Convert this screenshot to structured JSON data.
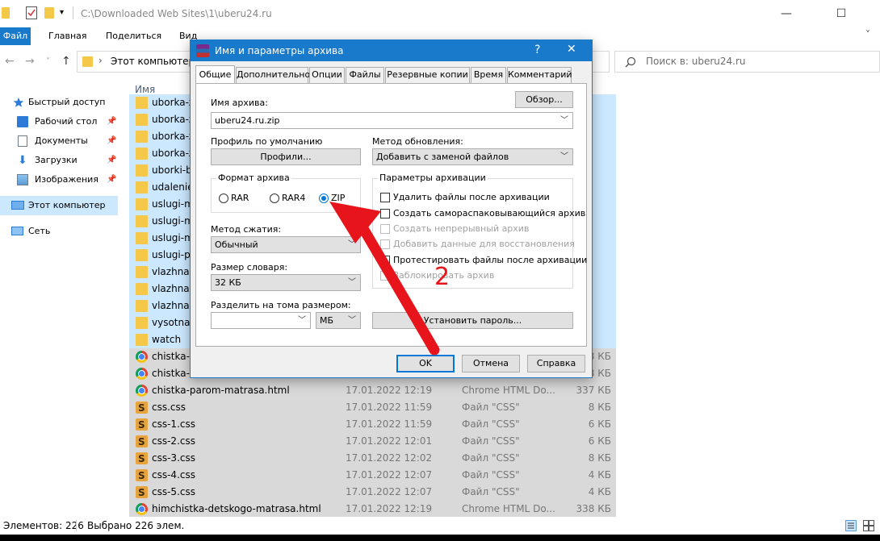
{
  "window": {
    "title_path": "C:\\Downloaded Web Sites\\1\\uberu24.ru",
    "minimize_glyph": "—",
    "maximize_glyph": "☐",
    "close_glyph": "✕"
  },
  "ribbon": {
    "tabs": [
      "Файл",
      "Главная",
      "Поделиться",
      "Вид"
    ]
  },
  "address": {
    "path_label": "Этот компьютер",
    "search_placeholder": "Поиск в: uberu24.ru"
  },
  "nav": {
    "items": [
      {
        "label": "Быстрый доступ",
        "icon": "star-icon"
      },
      {
        "label": "Рабочий стол",
        "icon": "desktop-icon"
      },
      {
        "label": "Документы",
        "icon": "documents-icon"
      },
      {
        "label": "Загрузки",
        "icon": "downloads-icon"
      },
      {
        "label": "Изображения",
        "icon": "pictures-icon"
      },
      {
        "label": "Этот компьютер",
        "icon": "computer-icon"
      },
      {
        "label": "Сеть",
        "icon": "network-icon"
      }
    ]
  },
  "files": {
    "column_name": "Имя",
    "rows": [
      {
        "name": "uborka-z",
        "date": "",
        "type": "",
        "size": "",
        "icon": "folder"
      },
      {
        "name": "uborka-z",
        "date": "",
        "type": "",
        "size": "",
        "icon": "folder"
      },
      {
        "name": "uborka-z",
        "date": "",
        "type": "",
        "size": "",
        "icon": "folder"
      },
      {
        "name": "uborka-z",
        "date": "",
        "type": "",
        "size": "",
        "icon": "folder"
      },
      {
        "name": "uborki-b",
        "date": "",
        "type": "",
        "size": "",
        "icon": "folder"
      },
      {
        "name": "udalenie-",
        "date": "",
        "type": "",
        "size": "",
        "icon": "folder"
      },
      {
        "name": "uslugi-m",
        "date": "",
        "type": "",
        "size": "",
        "icon": "folder"
      },
      {
        "name": "uslugi-m",
        "date": "",
        "type": "",
        "size": "",
        "icon": "folder"
      },
      {
        "name": "uslugi-m",
        "date": "",
        "type": "",
        "size": "",
        "icon": "folder"
      },
      {
        "name": "uslugi-po",
        "date": "",
        "type": "",
        "size": "",
        "icon": "folder"
      },
      {
        "name": "vlazhnay",
        "date": "",
        "type": "",
        "size": "",
        "icon": "folder"
      },
      {
        "name": "vlazhnay",
        "date": "",
        "type": "",
        "size": "",
        "icon": "folder"
      },
      {
        "name": "vlazhnay",
        "date": "",
        "type": "",
        "size": "",
        "icon": "folder"
      },
      {
        "name": "vysotnay",
        "date": "",
        "type": "",
        "size": "",
        "icon": "folder"
      },
      {
        "name": "watch",
        "date": "",
        "type": "",
        "size": "",
        "icon": "folder"
      },
      {
        "name": "chistka-r",
        "date": "",
        "type": "",
        "size": "8 КБ",
        "icon": "chrome"
      },
      {
        "name": "chistka-r",
        "date": "",
        "type": "",
        "size": "8 КБ",
        "icon": "chrome"
      },
      {
        "name": "chistka-parom-matrasa.html",
        "date": "17.01.2022 12:19",
        "type": "Chrome HTML Do...",
        "size": "337 КБ",
        "icon": "chrome"
      },
      {
        "name": "css.css",
        "date": "17.01.2022 11:59",
        "type": "Файл \"CSS\"",
        "size": "8 КБ",
        "icon": "css"
      },
      {
        "name": "css-1.css",
        "date": "17.01.2022 11:59",
        "type": "Файл \"CSS\"",
        "size": "6 КБ",
        "icon": "css"
      },
      {
        "name": "css-2.css",
        "date": "17.01.2022 12:01",
        "type": "Файл \"CSS\"",
        "size": "6 КБ",
        "icon": "css"
      },
      {
        "name": "css-3.css",
        "date": "17.01.2022 12:02",
        "type": "Файл \"CSS\"",
        "size": "8 КБ",
        "icon": "css"
      },
      {
        "name": "css-4.css",
        "date": "17.01.2022 12:07",
        "type": "Файл \"CSS\"",
        "size": "4 КБ",
        "icon": "css"
      },
      {
        "name": "css-5.css",
        "date": "17.01.2022 12:07",
        "type": "Файл \"CSS\"",
        "size": "4 КБ",
        "icon": "css"
      },
      {
        "name": "himchistka-detskogo-matrasa.html",
        "date": "17.01.2022 12:19",
        "type": "Chrome HTML Do...",
        "size": "338 КБ",
        "icon": "chrome"
      }
    ]
  },
  "status": {
    "items_count": "Элементов: 226",
    "selected": "Выбрано 226 элем."
  },
  "dialog": {
    "title": "Имя и параметры архива",
    "help_glyph": "?",
    "close_glyph": "✕",
    "tabs": [
      "Общие",
      "Дополнительно",
      "Опции",
      "Файлы",
      "Резервные копии",
      "Время",
      "Комментарий"
    ],
    "archive_name_label": "Имя архива:",
    "browse_button": "Обзор...",
    "archive_name_value": "uberu24.ru.zip",
    "default_profile_label": "Профиль по умолчанию",
    "profiles_button": "Профили...",
    "update_method_label": "Метод обновления:",
    "update_method_value": "Добавить с заменой файлов",
    "format_group_label": "Формат архива",
    "formats": [
      "RAR",
      "RAR4",
      "ZIP"
    ],
    "selected_format": "ZIP",
    "compression_label": "Метод сжатия:",
    "compression_value": "Обычный",
    "dictionary_label": "Размер словаря:",
    "dictionary_value": "32 КБ",
    "split_label": "Разделить на тома размером:",
    "split_value": "",
    "split_unit": "МБ",
    "options_group_label": "Параметры архивации",
    "options": [
      {
        "label": "Удалить файлы после архивации",
        "enabled": true
      },
      {
        "label": "Создать самораспаковывающийся архив",
        "enabled": true
      },
      {
        "label": "Создать непрерывный архив",
        "enabled": false
      },
      {
        "label": "Добавить данные для восстановления",
        "enabled": false
      },
      {
        "label": "Протестировать файлы после архивации",
        "enabled": true
      },
      {
        "label": "Заблокировать архив",
        "enabled": false
      }
    ],
    "password_button": "Установить пароль...",
    "ok_button": "OK",
    "cancel_button": "Отмена",
    "help_button": "Справка"
  },
  "annotation": {
    "number": "2",
    "color": "#e8141c"
  }
}
